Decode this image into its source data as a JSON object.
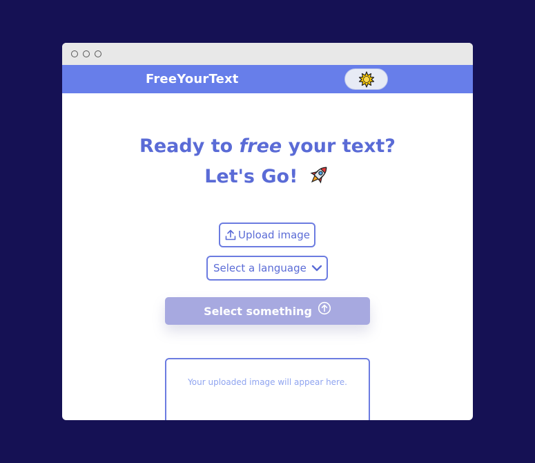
{
  "app": {
    "brand": "FreeYourText"
  },
  "theme_toggle": {
    "icon": "sun-icon"
  },
  "hero": {
    "line1_before": "Ready to ",
    "line1_em": "free",
    "line1_after": " your text?",
    "line2": "Let's Go!",
    "emoji_icon": "rocket-icon"
  },
  "upload": {
    "label": "Upload image",
    "icon": "upload-icon"
  },
  "language": {
    "selected": "Select a language",
    "icon": "chevron-down-icon"
  },
  "submit": {
    "label": "Select something",
    "icon": "arrow-up-circle-icon"
  },
  "preview": {
    "placeholder": "Your uploaded image will appear here."
  },
  "colors": {
    "page_background": "#151154",
    "navbar": "#677eea",
    "accent": "#5a6bd6",
    "disabled_button": "#a7a9e0"
  }
}
